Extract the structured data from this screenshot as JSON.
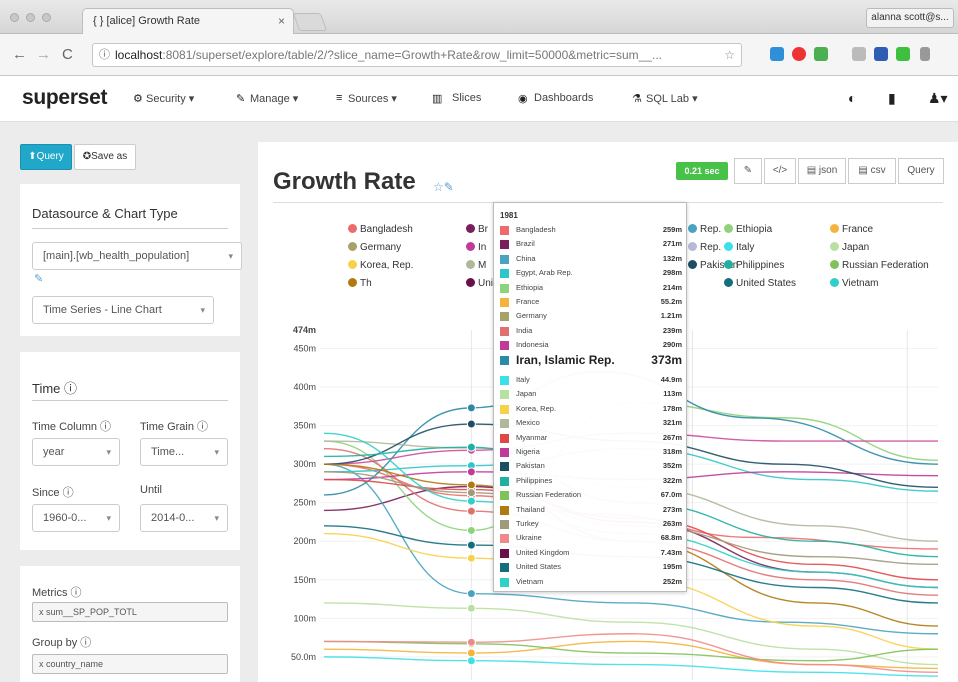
{
  "browser": {
    "tab_title": "{ } [alice] Growth Rate",
    "tab_close": "×",
    "user_chip": "alanna scott@s...",
    "back": "←",
    "forward": "→",
    "reload": "C",
    "url_host": "localhost",
    "url_rest": ":8081/superset/explore/table/2/?slice_name=Growth+Rate&row_limit=50000&metric=sum__...",
    "url_info_icon": "ⓘ",
    "url_star": "☆"
  },
  "navbar": {
    "brand": "superset",
    "items": [
      {
        "label": "Security ▾",
        "icon": "gear-icon",
        "glyph": "⚙"
      },
      {
        "label": "Manage ▾",
        "icon": "wrench-icon",
        "glyph": "✎"
      },
      {
        "label": "Sources ▾",
        "icon": "database-icon",
        "glyph": "≡"
      },
      {
        "label": "Slices",
        "icon": "bar-chart-icon",
        "glyph": "▥"
      },
      {
        "label": "Dashboards",
        "icon": "dashboard-icon",
        "glyph": "◉"
      },
      {
        "label": "SQL Lab ▾",
        "icon": "flask-icon",
        "glyph": "⚗"
      }
    ],
    "right_icons": [
      {
        "name": "github-icon",
        "glyph": "◐"
      },
      {
        "name": "book-icon",
        "glyph": "▮"
      },
      {
        "name": "user-icon",
        "glyph": "♟▾"
      }
    ]
  },
  "controls": {
    "query_button": "⬆Query",
    "save_button": "✪Save as",
    "datasource_section": "Datasource & Chart Type",
    "datasource_value": "[main].[wb_health_population]",
    "datasource_edit": "✎",
    "viz_type": "Time Series - Line Chart",
    "time_section": "Time ⓘ",
    "time_column_label": "Time Column ⓘ",
    "time_grain_label": "Time Grain ⓘ",
    "time_column_value": "year",
    "time_grain_value": "Time...",
    "since_label": "Since ⓘ",
    "until_label": "Until",
    "since_value": "1960-0...",
    "until_value": "2014-0...",
    "metrics_label": "Metrics ⓘ",
    "metric_tag": "x sum__SP_POP_TOTL",
    "groupby_label": "Group by ⓘ",
    "groupby_tag": "x country_name"
  },
  "chart": {
    "title": "Growth Rate",
    "title_icons": "☆✎",
    "time_badge": "0.21 sec",
    "buttons": [
      "✎",
      "</>",
      "▤ json",
      "▤ csv",
      "Query"
    ],
    "y_ticks": [
      "474m",
      "450m",
      "400m",
      "350m",
      "300m",
      "250m",
      "200m",
      "150m",
      "100m",
      "50.0m"
    ],
    "legend_visible": [
      {
        "name": "Bangladesh",
        "color": "#ef6a6a"
      },
      {
        "name": "Br",
        "color": "#7a1f5c"
      },
      {
        "name": "Rep.",
        "color": "#4aa3c0"
      },
      {
        "name": "Ethiopia",
        "color": "#8ed37a"
      },
      {
        "name": "France",
        "color": "#f5b23c"
      },
      {
        "name": "Germany",
        "color": "#a7a26a"
      },
      {
        "name": "In",
        "color": "#c03a9a"
      },
      {
        "name": "Rep.",
        "color": "#b8b8d8"
      },
      {
        "name": "Italy",
        "color": "#3de0e8"
      },
      {
        "name": "Japan",
        "color": "#b8e0a0"
      },
      {
        "name": "Korea, Rep.",
        "color": "#f7d14a"
      },
      {
        "name": "M",
        "color": "#b0b89a"
      },
      {
        "name": "Pakistan",
        "color": "#1e4e63"
      },
      {
        "name": "Philippines",
        "color": "#1fb0a0"
      },
      {
        "name": "Russian Federation",
        "color": "#7fc25a"
      },
      {
        "name": "Th",
        "color": "#b07a10"
      },
      {
        "name": "United Kingdom",
        "color": "#6a1048"
      },
      {
        "name": "United States",
        "color": "#156e7e"
      },
      {
        "name": "Vietnam",
        "color": "#2fd0c8"
      }
    ],
    "tooltip": {
      "header": "1981",
      "rows": [
        {
          "name": "Bangladesh",
          "value": "259m",
          "color": "#ef6a6a"
        },
        {
          "name": "Brazil",
          "value": "271m",
          "color": "#7a1f5c"
        },
        {
          "name": "China",
          "value": "132m",
          "color": "#4aa3c0"
        },
        {
          "name": "Egypt, Arab Rep.",
          "value": "298m",
          "color": "#2ec6c9"
        },
        {
          "name": "Ethiopia",
          "value": "214m",
          "color": "#8ed37a"
        },
        {
          "name": "France",
          "value": "55.2m",
          "color": "#f5b23c"
        },
        {
          "name": "Germany",
          "value": "1.21m",
          "color": "#a7a26a"
        },
        {
          "name": "India",
          "value": "239m",
          "color": "#e07070"
        },
        {
          "name": "Indonesia",
          "value": "290m",
          "color": "#c03a9a"
        },
        {
          "name": "Iran, Islamic Rep.",
          "value": "373m",
          "color": "#2c8aa6"
        },
        {
          "name": "Italy",
          "value": "44.9m",
          "color": "#3de0e8"
        },
        {
          "name": "Japan",
          "value": "113m",
          "color": "#b8e0a0"
        },
        {
          "name": "Korea, Rep.",
          "value": "178m",
          "color": "#f7d14a"
        },
        {
          "name": "Mexico",
          "value": "321m",
          "color": "#b0b89a"
        },
        {
          "name": "Myanmar",
          "value": "267m",
          "color": "#e04848"
        },
        {
          "name": "Nigeria",
          "value": "318m",
          "color": "#c03a9a"
        },
        {
          "name": "Pakistan",
          "value": "352m",
          "color": "#1e4e63"
        },
        {
          "name": "Philippines",
          "value": "322m",
          "color": "#1fb0a0"
        },
        {
          "name": "Russian Federation",
          "value": "67.0m",
          "color": "#7fc25a"
        },
        {
          "name": "Thailand",
          "value": "273m",
          "color": "#b07a10"
        },
        {
          "name": "Turkey",
          "value": "263m",
          "color": "#a09a7a"
        },
        {
          "name": "Ukraine",
          "value": "68.8m",
          "color": "#ef8a8a"
        },
        {
          "name": "United Kingdom",
          "value": "7.43m",
          "color": "#6a1048"
        },
        {
          "name": "United States",
          "value": "195m",
          "color": "#156e7e"
        },
        {
          "name": "Vietnam",
          "value": "252m",
          "color": "#2fd0c8"
        }
      ],
      "highlight_index": 9
    }
  },
  "chart_data": {
    "type": "line",
    "title": "Growth Rate",
    "ylim": [
      20,
      474
    ],
    "x_range": [
      0,
      1
    ],
    "hover_x": 0.24,
    "series": [
      {
        "name": "Bangladesh",
        "color": "#ef6a6a",
        "values": [
          [
            0,
            300
          ],
          [
            0.24,
            259
          ],
          [
            0.45,
            235
          ],
          [
            0.7,
            205
          ],
          [
            1,
            190
          ]
        ]
      },
      {
        "name": "Brazil",
        "color": "#7a1f5c",
        "values": [
          [
            0,
            240
          ],
          [
            0.24,
            271
          ],
          [
            0.5,
            225
          ],
          [
            0.8,
            160
          ],
          [
            1,
            140
          ]
        ]
      },
      {
        "name": "China",
        "color": "#4aa3c0",
        "values": [
          [
            0,
            300
          ],
          [
            0.24,
            132
          ],
          [
            0.5,
            120
          ],
          [
            0.75,
            95
          ],
          [
            1,
            80
          ]
        ]
      },
      {
        "name": "Egypt, Arab Rep.",
        "color": "#2ec6c9",
        "values": [
          [
            0,
            290
          ],
          [
            0.24,
            298
          ],
          [
            0.5,
            320
          ],
          [
            0.8,
            280
          ],
          [
            1,
            265
          ]
        ]
      },
      {
        "name": "Ethiopia",
        "color": "#8ed37a",
        "values": [
          [
            0,
            330
          ],
          [
            0.24,
            214
          ],
          [
            0.5,
            380
          ],
          [
            0.75,
            360
          ],
          [
            1,
            305
          ]
        ]
      },
      {
        "name": "France",
        "color": "#f5b23c",
        "values": [
          [
            0,
            60
          ],
          [
            0.24,
            55
          ],
          [
            0.5,
            70
          ],
          [
            0.8,
            40
          ],
          [
            1,
            35
          ]
        ]
      },
      {
        "name": "India",
        "color": "#e07070",
        "values": [
          [
            0,
            320
          ],
          [
            0.24,
            239
          ],
          [
            0.5,
            200
          ],
          [
            0.8,
            150
          ],
          [
            1,
            130
          ]
        ]
      },
      {
        "name": "Indonesia",
        "color": "#c03a9a",
        "values": [
          [
            0,
            280
          ],
          [
            0.24,
            290
          ],
          [
            0.5,
            280
          ],
          [
            0.75,
            290
          ],
          [
            1,
            285
          ]
        ]
      },
      {
        "name": "Iran, Islamic Rep.",
        "color": "#2c8aa6",
        "values": [
          [
            0,
            260
          ],
          [
            0.24,
            373
          ],
          [
            0.45,
            420
          ],
          [
            0.7,
            360
          ],
          [
            1,
            300
          ]
        ]
      },
      {
        "name": "Italy",
        "color": "#3de0e8",
        "values": [
          [
            0,
            50
          ],
          [
            0.24,
            45
          ],
          [
            0.5,
            40
          ],
          [
            0.8,
            30
          ],
          [
            1,
            25
          ]
        ]
      },
      {
        "name": "Japan",
        "color": "#b8e0a0",
        "values": [
          [
            0,
            120
          ],
          [
            0.24,
            113
          ],
          [
            0.5,
            95
          ],
          [
            0.8,
            60
          ],
          [
            1,
            40
          ]
        ]
      },
      {
        "name": "Korea, Rep.",
        "color": "#f7d14a",
        "values": [
          [
            0,
            210
          ],
          [
            0.24,
            178
          ],
          [
            0.5,
            150
          ],
          [
            0.8,
            90
          ],
          [
            1,
            60
          ]
        ]
      },
      {
        "name": "Mexico",
        "color": "#b0b89a",
        "values": [
          [
            0,
            330
          ],
          [
            0.24,
            321
          ],
          [
            0.5,
            270
          ],
          [
            0.8,
            220
          ],
          [
            1,
            200
          ]
        ]
      },
      {
        "name": "Myanmar",
        "color": "#e04848",
        "values": [
          [
            0,
            280
          ],
          [
            0.24,
            267
          ],
          [
            0.5,
            230
          ],
          [
            0.8,
            170
          ],
          [
            1,
            150
          ]
        ]
      },
      {
        "name": "Nigeria",
        "color": "#d04aa0",
        "values": [
          [
            0,
            300
          ],
          [
            0.24,
            318
          ],
          [
            0.5,
            340
          ],
          [
            0.75,
            330
          ],
          [
            1,
            330
          ]
        ]
      },
      {
        "name": "Pakistan",
        "color": "#1e4e63",
        "values": [
          [
            0,
            300
          ],
          [
            0.24,
            352
          ],
          [
            0.5,
            330
          ],
          [
            0.75,
            300
          ],
          [
            1,
            270
          ]
        ]
      },
      {
        "name": "Philippines",
        "color": "#1fb0a0",
        "values": [
          [
            0,
            310
          ],
          [
            0.24,
            322
          ],
          [
            0.5,
            250
          ],
          [
            0.8,
            200
          ],
          [
            1,
            180
          ]
        ]
      },
      {
        "name": "Russian Federation",
        "color": "#7fc25a",
        "values": [
          [
            0,
            70
          ],
          [
            0.24,
            67
          ],
          [
            0.5,
            55
          ],
          [
            0.8,
            45
          ],
          [
            1,
            60
          ]
        ]
      },
      {
        "name": "Thailand",
        "color": "#b07a10",
        "values": [
          [
            0,
            300
          ],
          [
            0.24,
            273
          ],
          [
            0.5,
            200
          ],
          [
            0.8,
            120
          ],
          [
            1,
            90
          ]
        ]
      },
      {
        "name": "Turkey",
        "color": "#a09a7a",
        "values": [
          [
            0,
            290
          ],
          [
            0.24,
            263
          ],
          [
            0.5,
            220
          ],
          [
            0.8,
            180
          ],
          [
            1,
            170
          ]
        ]
      },
      {
        "name": "Ukraine",
        "color": "#ef8a8a",
        "values": [
          [
            0,
            70
          ],
          [
            0.24,
            69
          ],
          [
            0.5,
            80
          ],
          [
            0.8,
            40
          ],
          [
            1,
            30
          ]
        ]
      },
      {
        "name": "United States",
        "color": "#156e7e",
        "values": [
          [
            0,
            220
          ],
          [
            0.24,
            195
          ],
          [
            0.5,
            180
          ],
          [
            0.8,
            140
          ],
          [
            1,
            120
          ]
        ]
      },
      {
        "name": "Vietnam",
        "color": "#2fd0c8",
        "values": [
          [
            0,
            340
          ],
          [
            0.24,
            252
          ],
          [
            0.5,
            210
          ],
          [
            0.8,
            160
          ],
          [
            1,
            140
          ]
        ]
      }
    ]
  }
}
